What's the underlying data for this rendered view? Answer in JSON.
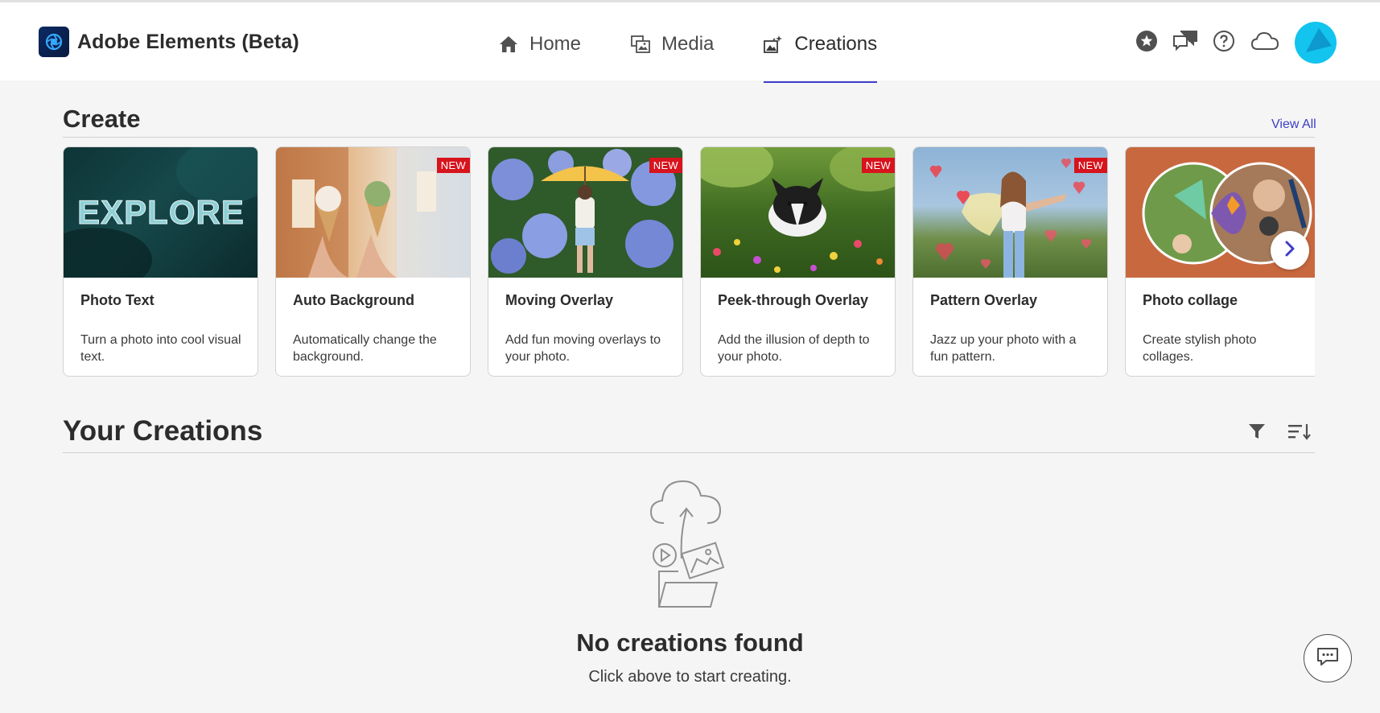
{
  "app": {
    "title": "Adobe Elements (Beta)"
  },
  "nav": {
    "tabs": [
      {
        "label": "Home",
        "icon": "home-icon"
      },
      {
        "label": "Media",
        "icon": "media-icon"
      },
      {
        "label": "Creations",
        "icon": "creations-icon",
        "active": true
      }
    ]
  },
  "header_actions": [
    "star-icon",
    "feedback-icon",
    "help-icon",
    "cloud-icon",
    "avatar"
  ],
  "create": {
    "title": "Create",
    "view_all": "View All",
    "badge": "NEW",
    "cards": [
      {
        "title": "Photo Text",
        "description": "Turn a photo into cool visual text.",
        "thumb_text": "EXPLORE",
        "is_new": false
      },
      {
        "title": "Auto Background",
        "description": "Automatically change the background.",
        "is_new": true
      },
      {
        "title": "Moving Overlay",
        "description": "Add fun moving overlays to your photo.",
        "is_new": true
      },
      {
        "title": "Peek-through Overlay",
        "description": "Add the illusion of depth to your photo.",
        "is_new": true
      },
      {
        "title": "Pattern Overlay",
        "description": "Jazz up your photo with a fun pattern.",
        "is_new": true
      },
      {
        "title": "Photo collage",
        "description": "Create stylish photo collages.",
        "is_new": false
      }
    ]
  },
  "creations": {
    "title": "Your Creations",
    "empty_title": "No creations found",
    "empty_subtitle": "Click above to start creating."
  },
  "colors": {
    "accent": "#3c3dc8",
    "badge": "#d7141d",
    "avatar": "#12c4ee",
    "background": "#f5f5f5"
  }
}
